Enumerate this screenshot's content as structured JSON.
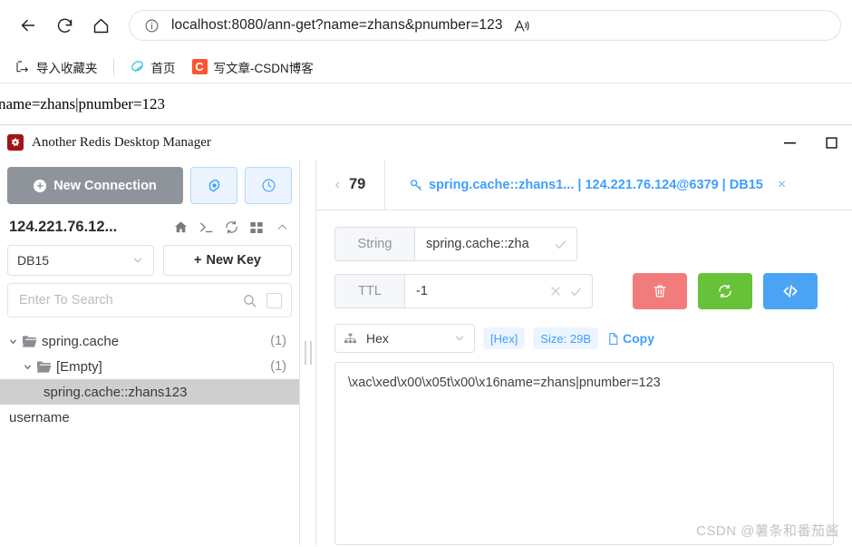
{
  "browser": {
    "nav": {
      "back_label": "Back",
      "reload_label": "Refresh",
      "home_label": "Home"
    },
    "address": {
      "value": "localhost:8080/ann-get?name=zhans&pnumber=123",
      "host": "localhost",
      "rest": ":8080/ann-get?name=zhans&pnumber=123",
      "read_aloud_label": "A"
    },
    "bookmarks": [
      {
        "label": "导入收藏夹",
        "icon": "import-favorites-icon"
      },
      {
        "label": "首页",
        "icon": "home-page-icon"
      },
      {
        "label": "写文章-CSDN博客",
        "icon": "csdn-icon",
        "badge": "C"
      }
    ],
    "page_body_text": "name=zhans|pnumber=123"
  },
  "app": {
    "title": "Another Redis Desktop Manager",
    "window_controls": {
      "minimize": "—",
      "maximize": "□"
    }
  },
  "sidebar": {
    "new_connection_label": "New Connection",
    "settings_icon": "gear-icon",
    "history_icon": "clock-icon",
    "connection_name": "124.221.76.12...",
    "connection_actions": [
      {
        "name": "home-icon"
      },
      {
        "name": "terminal-icon"
      },
      {
        "name": "refresh-icon"
      },
      {
        "name": "grid-icon"
      },
      {
        "name": "chevron-up-icon"
      }
    ],
    "db_selected": "DB15",
    "new_key_label": "New Key",
    "search_placeholder": "Enter To Search",
    "tree": [
      {
        "label": "spring.cache",
        "count": "(1)",
        "indent": 0,
        "type": "folder",
        "expanded": true,
        "selected": false
      },
      {
        "label": "[Empty]",
        "count": "(1)",
        "indent": 1,
        "type": "folder",
        "expanded": true,
        "selected": false
      },
      {
        "label": "spring.cache::zhans123",
        "count": "",
        "indent": 2,
        "type": "key",
        "expanded": false,
        "selected": true
      },
      {
        "label": "username",
        "count": "",
        "indent": 0,
        "type": "key",
        "expanded": false,
        "selected": false
      }
    ]
  },
  "tabs": {
    "prev_arrow": "‹",
    "counter": "79",
    "active": {
      "icon": "key-icon",
      "label": "spring.cache::zhans1... | 124.221.76.124@6379 | DB15",
      "close": "×"
    }
  },
  "key_detail": {
    "type_label": "String",
    "key_name": "spring.cache::zha",
    "ttl_label": "TTL",
    "ttl_value": "-1",
    "buttons": {
      "delete": "trash-icon",
      "refresh": "refresh-icon",
      "code": "code-icon"
    },
    "format_selected": "Hex",
    "format_badge": "[Hex]",
    "size_badge": "Size: 29B",
    "copy_label": "Copy",
    "value": "\\xac\\xed\\x00\\x05t\\x00\\x16name=zhans|pnumber=123"
  },
  "watermark": "CSDN @薯条和番茄酱",
  "colors": {
    "accent_blue": "#409eff",
    "new_connection_gray": "#8f949b",
    "delete_red": "#f27c7c",
    "refresh_green": "#67c23a",
    "code_blue": "#4aa3f5",
    "selected_row": "#cfcfcf",
    "csdn_orange": "#fc5531",
    "app_icon_red": "#a31515"
  }
}
